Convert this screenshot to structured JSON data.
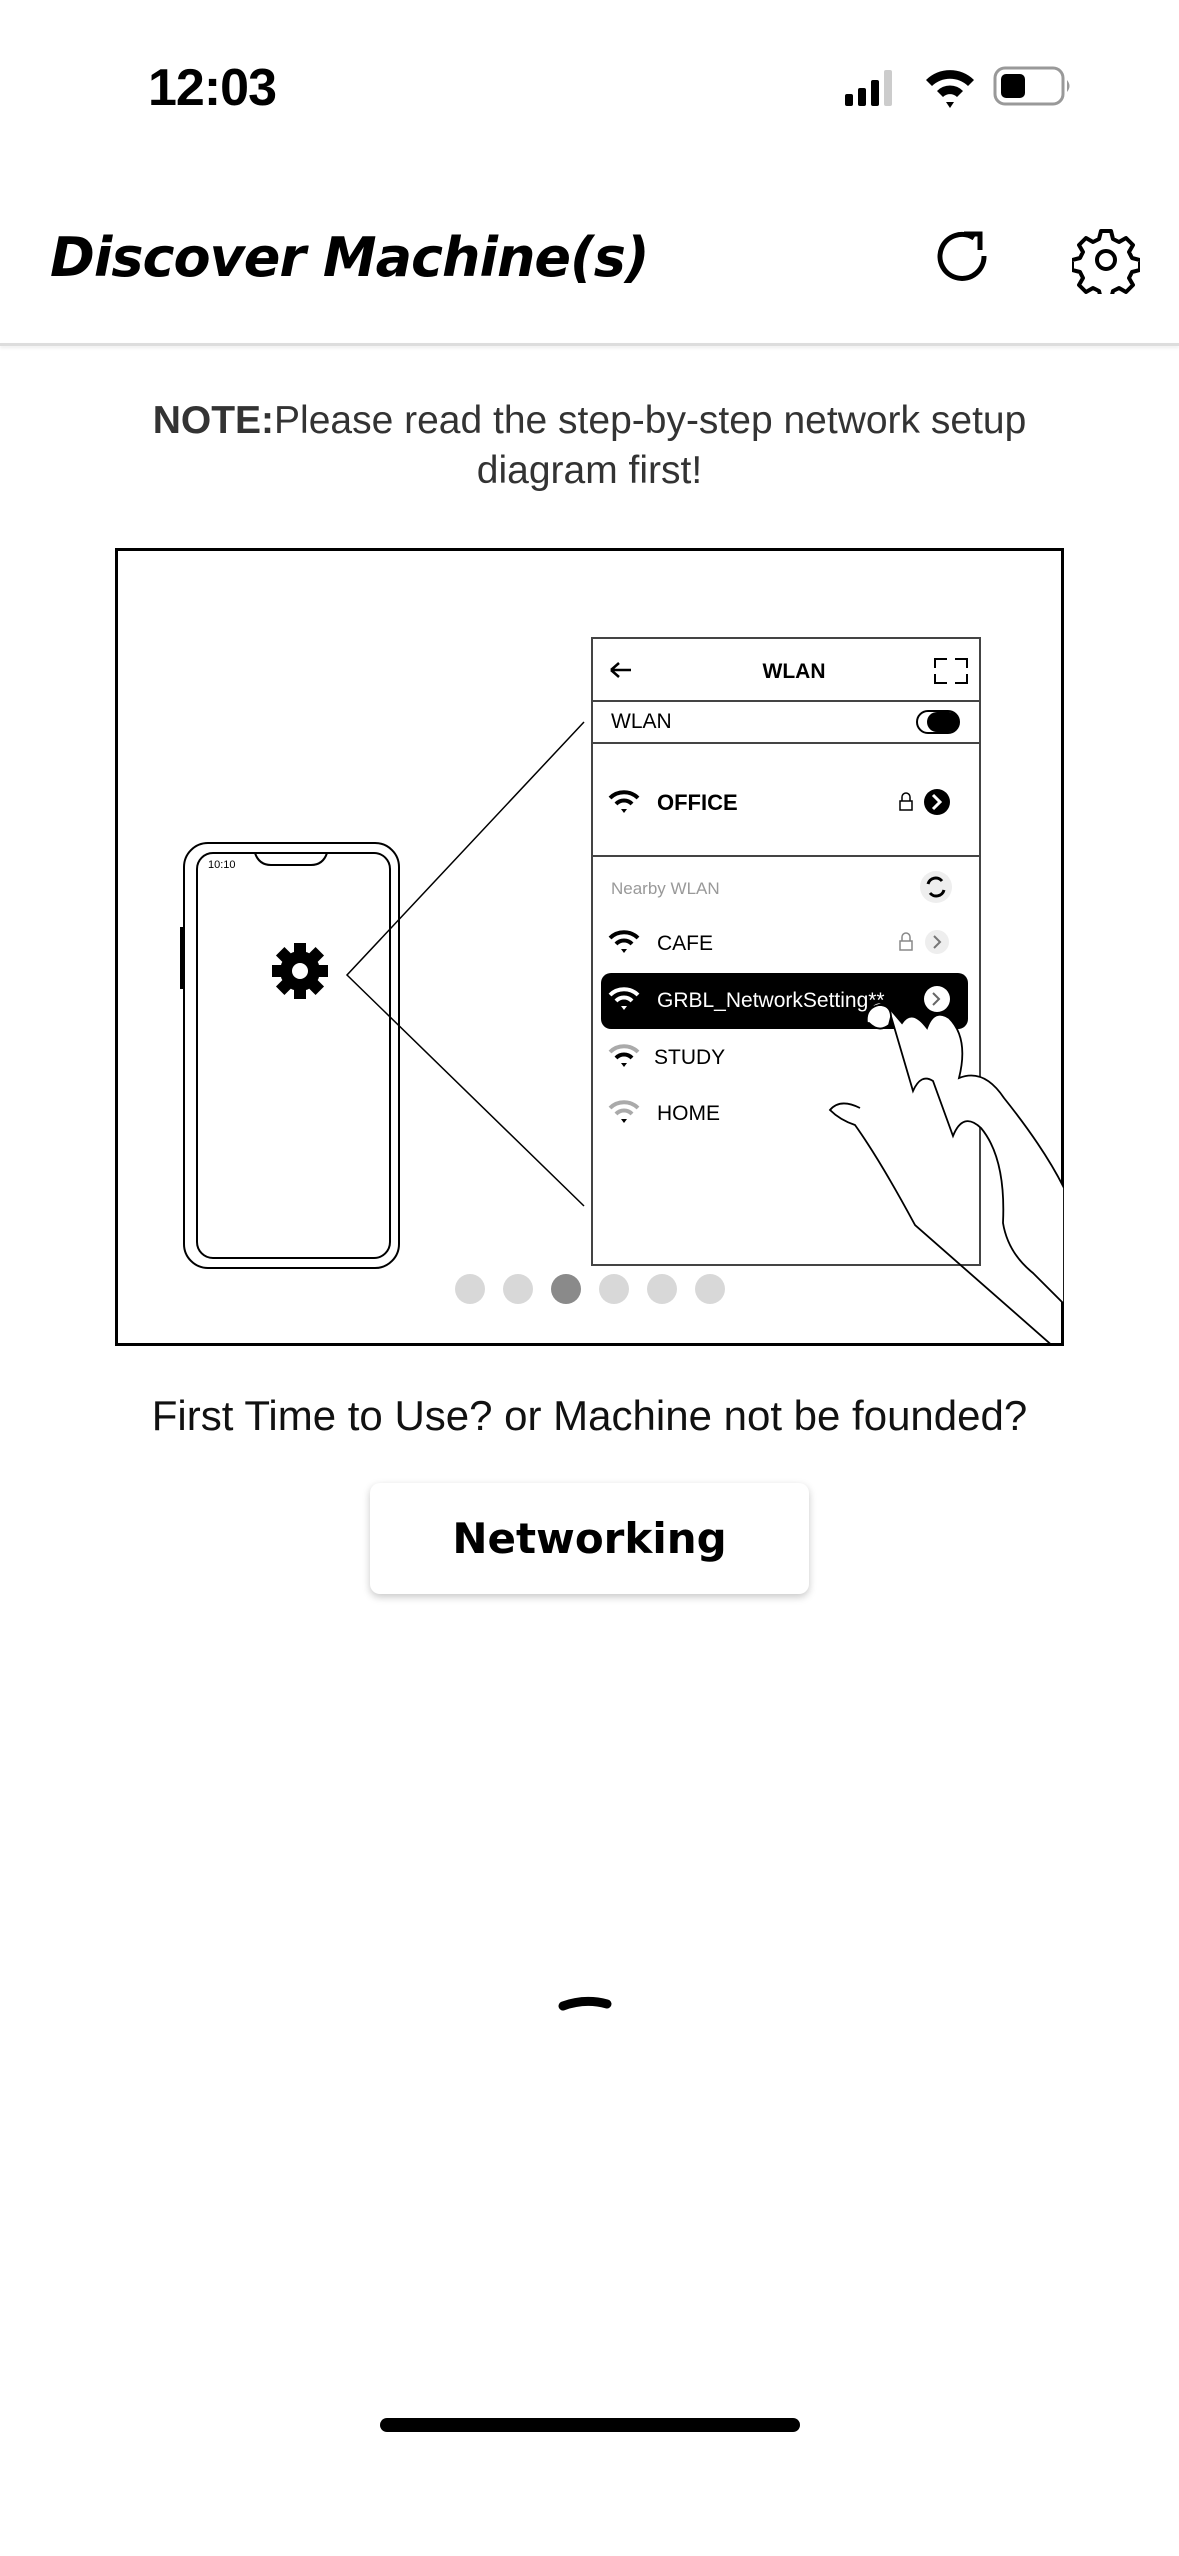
{
  "status_bar": {
    "time": "12:03",
    "icons": [
      "cellular-signal-icon",
      "wifi-icon",
      "battery-icon"
    ]
  },
  "header": {
    "title": "Discover Machine(s)",
    "refresh_icon": "refresh-icon",
    "settings_icon": "gear-icon"
  },
  "note": {
    "label": "NOTE:",
    "text": "Please read the step-by-step network setup diagram first!"
  },
  "diagram": {
    "phone_time": "10:10",
    "screen_title": "WLAN",
    "wlan_label": "WLAN",
    "connected_network": "OFFICE",
    "nearby_label": "Nearby WLAN",
    "networks": [
      "CAFE",
      "GRBL_NetworkSetting**",
      "STUDY",
      "HOME"
    ],
    "highlighted_network": "GRBL_NetworkSetting**",
    "carousel": {
      "total": 6,
      "active_index": 2
    }
  },
  "prompt": {
    "question": "First Time to Use? or Machine not be founded?",
    "networking_button": "Networking"
  },
  "colors": {
    "accent": "#000000",
    "dot_inactive": "#d8d8d8",
    "dot_active": "#8a8a8a"
  }
}
